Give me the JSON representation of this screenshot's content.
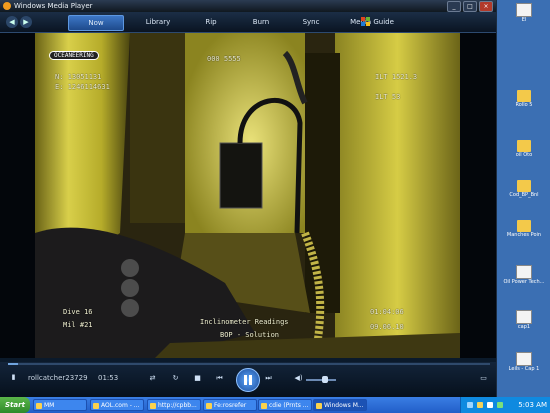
{
  "window": {
    "title": "Windows Media Player",
    "controls": [
      "_",
      "□",
      "×"
    ]
  },
  "nav": {
    "back": "◀",
    "forward": "▶",
    "tabs": [
      "Now Playing",
      "Library",
      "Rip",
      "Burn",
      "Sync",
      "Media Guide"
    ]
  },
  "video_overlay": {
    "tag": "OCEANEERING",
    "coords_1": "N: 13051131",
    "coords_2": "E: 1246114631",
    "right_1": "ILT   1521.3",
    "right_2": "ILT     53",
    "bottom_left_1": "Dive 16",
    "bottom_left_2": "Mil  #21",
    "caption_1": "Inclinometer Readings",
    "caption_2": "BOP - Solution",
    "time": "01:04:06",
    "date": "09.06.10",
    "top_code": "000   5555"
  },
  "player": {
    "file_name": "rollcatcher23729",
    "time_elapsed": "01:53",
    "progress": 0.02,
    "volume": 0.6
  },
  "desktop_icons": [
    {
      "label": "El",
      "type": "doc"
    },
    {
      "label": "Rollo 5",
      "type": "folder"
    },
    {
      "label": "oil Oto",
      "type": "folder"
    },
    {
      "label": "Cod_BP_Bnl",
      "type": "folder"
    },
    {
      "label": "Manches Poin",
      "type": "folder"
    },
    {
      "label": "Oil Power Tech...",
      "type": "doc"
    },
    {
      "label": "cap1",
      "type": "doc"
    },
    {
      "label": "Leils - Cap 1",
      "type": "doc"
    }
  ],
  "taskbar": {
    "start_label": "Start",
    "items": [
      {
        "label": "MM",
        "active": false
      },
      {
        "label": "AOL.com - ...",
        "active": false
      },
      {
        "label": "http://cpbb...",
        "active": false
      },
      {
        "label": "Fe:rosrefer",
        "active": false
      },
      {
        "label": "cdie (Prnts ...",
        "active": false
      },
      {
        "label": "Windows M...",
        "active": true
      }
    ],
    "clock": "5:03 AM"
  },
  "colors": {
    "accent": "#3d77c6",
    "video_yellow": "#c8bf3a",
    "taskbar": "#2a6ed6"
  }
}
